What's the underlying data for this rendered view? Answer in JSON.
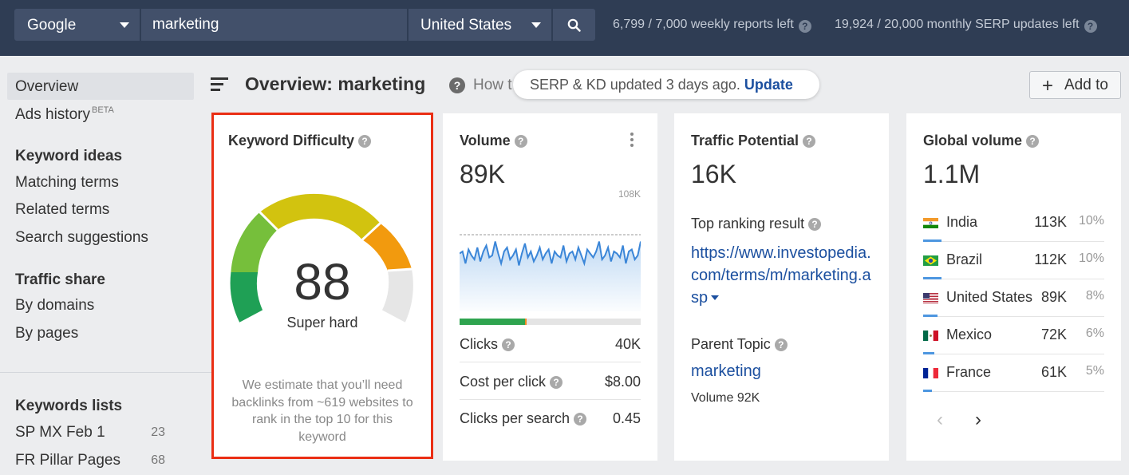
{
  "topbar": {
    "engine": "Google",
    "query": "marketing",
    "country": "United States",
    "weekly_reports": "6,799 / 7,000 weekly reports left",
    "monthly_serp": "19,924 / 20,000 monthly SERP updates left"
  },
  "sidebar": {
    "overview": "Overview",
    "ads_history": "Ads history",
    "beta": "BETA",
    "keyword_ideas": "Keyword ideas",
    "matching_terms": "Matching terms",
    "related_terms": "Related terms",
    "search_suggestions": "Search suggestions",
    "traffic_share": "Traffic share",
    "by_domains": "By domains",
    "by_pages": "By pages",
    "keywords_lists": "Keywords lists",
    "lists": [
      {
        "name": "SP MX Feb 1",
        "count": "23"
      },
      {
        "name": "FR Pillar Pages",
        "count": "68"
      }
    ]
  },
  "header": {
    "title": "Overview: marketing",
    "how_to": "How t",
    "toast_text": "SERP & KD updated 3 days ago.",
    "toast_link": "Update",
    "add_to": "Add to"
  },
  "kd": {
    "title": "Keyword Difficulty",
    "value": "88",
    "score": 88,
    "label": "Super hard",
    "note": "We estimate that you’ll need backlinks from ~619 websites to rank in the top 10 for this keyword"
  },
  "volume": {
    "title": "Volume",
    "value": "89K",
    "axis_max": "108K",
    "clicks_split": {
      "organic": 0.36,
      "paid": 0.01
    },
    "metrics": [
      {
        "label": "Clicks",
        "value": "40K"
      },
      {
        "label": "Cost per click",
        "value": "$8.00"
      },
      {
        "label": "Clicks per search",
        "value": "0.45"
      }
    ],
    "trend": [
      89,
      90,
      84,
      91,
      88,
      86,
      92,
      85,
      90,
      93,
      87,
      88,
      95,
      89,
      84,
      90,
      92,
      86,
      88,
      91,
      83,
      89,
      94,
      87,
      90,
      85,
      88,
      92,
      86,
      89,
      91,
      84,
      90,
      88,
      87,
      93,
      85,
      89,
      90,
      86,
      92,
      88,
      84,
      91,
      89,
      87,
      90,
      95,
      86,
      88,
      92,
      85,
      90,
      89,
      87,
      93,
      84,
      90,
      91,
      86,
      88,
      95
    ]
  },
  "traffic_potential": {
    "title": "Traffic Potential",
    "value": "16K",
    "top_result_label": "Top ranking result",
    "top_result_url": "https://www.investopedia.com/terms/m/marketing.asp",
    "parent_topic_label": "Parent Topic",
    "parent_topic": "marketing",
    "parent_volume": "Volume 92K"
  },
  "global_volume": {
    "title": "Global volume",
    "value": "1.1M",
    "countries": [
      {
        "name": "India",
        "value": "113K",
        "pct": "10%",
        "share": 0.1
      },
      {
        "name": "Brazil",
        "value": "112K",
        "pct": "10%",
        "share": 0.1
      },
      {
        "name": "United States",
        "value": "89K",
        "pct": "8%",
        "share": 0.08
      },
      {
        "name": "Mexico",
        "value": "72K",
        "pct": "6%",
        "share": 0.06
      },
      {
        "name": "France",
        "value": "61K",
        "pct": "5%",
        "share": 0.05
      }
    ],
    "prev": "‹",
    "next": "›"
  }
}
